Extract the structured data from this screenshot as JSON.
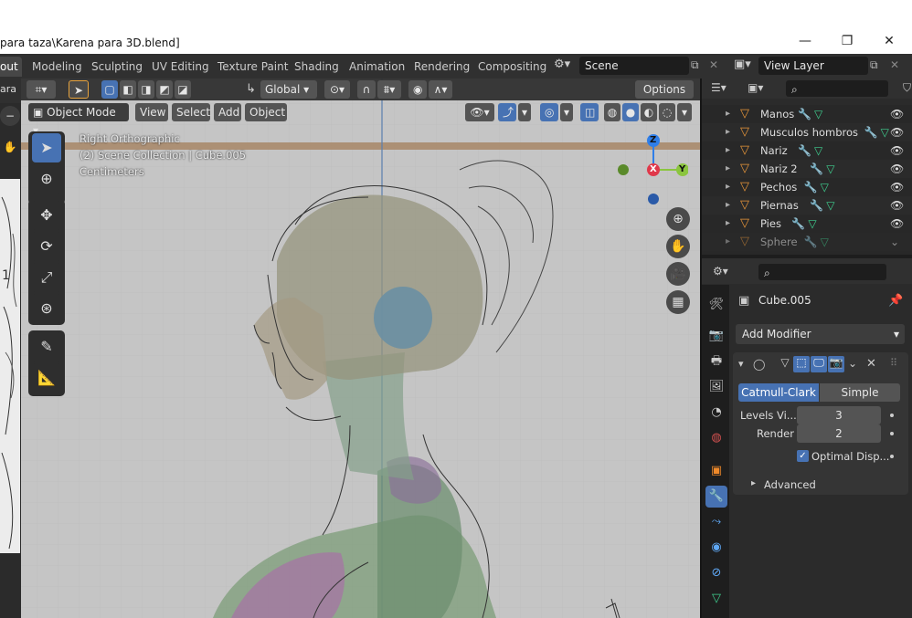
{
  "window": {
    "title": "para taza\\Karena para 3D.blend]",
    "minimize": "—",
    "maximize": "❐",
    "close": "✕"
  },
  "workspaces": {
    "tabs": [
      "out",
      "Modeling",
      "Sculpting",
      "UV Editing",
      "Texture Paint",
      "Shading",
      "Animation",
      "Rendering",
      "Compositing"
    ],
    "active": "out",
    "scene_label": "Scene",
    "view_layer_label": "View Layer"
  },
  "viewport_header": {
    "transform_orientation": "Global",
    "options_label": "Options",
    "mode": "Object Mode",
    "menus": [
      "View",
      "Select",
      "Add",
      "Object"
    ]
  },
  "viewport_overlay": {
    "view_name": "Right Orthographic",
    "collection_info": "(2) Scene Collection | Cube.005",
    "units": "Centimeters"
  },
  "gizmo": {
    "z": "Z",
    "x": "X",
    "y": "Y"
  },
  "left_panel_partial_text": "ara",
  "outliner": {
    "items": [
      {
        "name": "Manos"
      },
      {
        "name": "Musculos hombros"
      },
      {
        "name": "Nariz"
      },
      {
        "name": "Nariz 2"
      },
      {
        "name": "Pechos"
      },
      {
        "name": "Piernas"
      },
      {
        "name": "Pies"
      },
      {
        "name": "Sphere"
      }
    ]
  },
  "properties": {
    "object_name": "Cube.005",
    "add_modifier_label": "Add Modifier",
    "subdivision_types": [
      "Catmull-Clark",
      "Simple"
    ],
    "active_type": "Catmull-Clark",
    "fields": [
      {
        "label": "Levels Vi...",
        "value": "3"
      },
      {
        "label": "Render",
        "value": "2"
      }
    ],
    "optimal_display_label": "Optimal Disp...",
    "optimal_display_checked": true,
    "advanced_label": "Advanced"
  },
  "colors": {
    "accent": "#4772b3",
    "viewport_bg": "#393939",
    "x_axis": "#e0384a",
    "y_axis": "#8bc53f",
    "z_axis": "#2f7ee8",
    "mesh_icon": "#e8963a",
    "modifier_icon": "#5fa8f5",
    "data_icon": "#3fcf8f"
  }
}
